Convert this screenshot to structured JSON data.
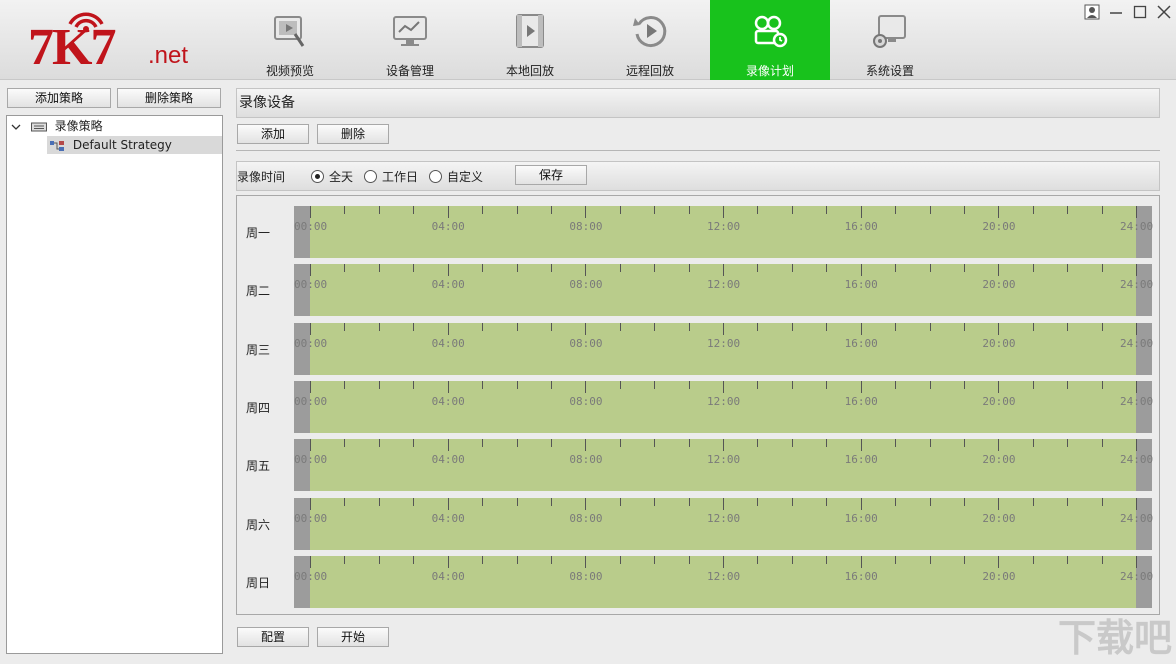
{
  "app": {
    "logo_main": "7K7",
    "logo_suffix": ".net",
    "watermark": "下载吧"
  },
  "nav": {
    "items": [
      {
        "label": "视频预览",
        "icon": "video-preview-icon",
        "active": false
      },
      {
        "label": "设备管理",
        "icon": "device-manage-icon",
        "active": false
      },
      {
        "label": "本地回放",
        "icon": "local-playback-icon",
        "active": false
      },
      {
        "label": "远程回放",
        "icon": "remote-playback-icon",
        "active": false
      },
      {
        "label": "录像计划",
        "icon": "record-plan-icon",
        "active": true
      },
      {
        "label": "系统设置",
        "icon": "system-settings-icon",
        "active": false
      }
    ]
  },
  "window_controls": [
    "user-icon",
    "minimize-icon",
    "maximize-icon",
    "close-icon"
  ],
  "left": {
    "add_strategy": "添加策略",
    "delete_strategy": "删除策略",
    "tree_root": "录像策略",
    "tree_child": "Default Strategy"
  },
  "right": {
    "section_title": "录像设备",
    "add": "添加",
    "delete": "删除",
    "time_label": "录像时间",
    "radios": [
      {
        "label": "全天",
        "checked": true
      },
      {
        "label": "工作日",
        "checked": false
      },
      {
        "label": "自定义",
        "checked": false
      }
    ],
    "save": "保存",
    "config": "配置",
    "start": "开始"
  },
  "schedule": {
    "days": [
      "周一",
      "周二",
      "周三",
      "周四",
      "周五",
      "周六",
      "周日"
    ],
    "time_labels": [
      "00:00",
      "04:00",
      "08:00",
      "12:00",
      "16:00",
      "20:00",
      "24:00"
    ],
    "fill_color": "#b9cc8b",
    "cap_color": "#9c9c9c"
  },
  "colors": {
    "active_tab": "#18c21c",
    "logo_red": "#c0141b"
  }
}
